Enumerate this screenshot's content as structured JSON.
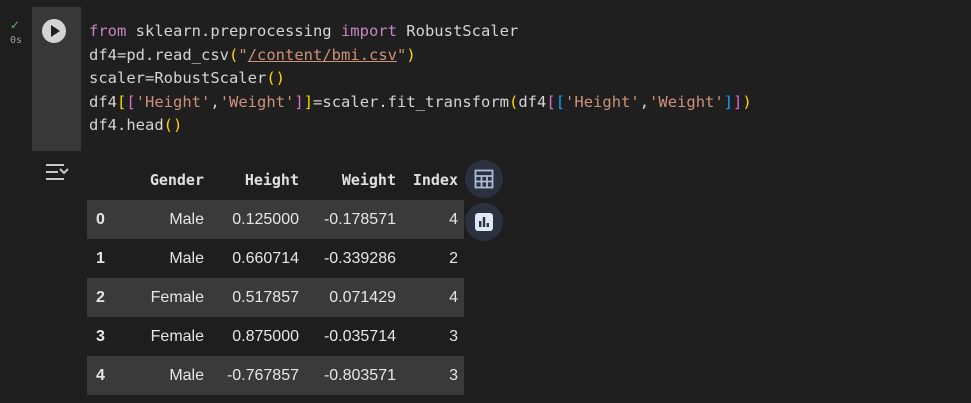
{
  "status": {
    "check": "✓",
    "time": "0s"
  },
  "code": {
    "line1_kw1": "from",
    "line1_mid": " sklearn.preprocessing ",
    "line1_kw2": "import",
    "line1_end": " RobustScaler",
    "line2_a": "df4=pd.read_csv",
    "line2_paren_open": "(",
    "line2_str_open": "\"",
    "line2_url": "/content/bmi.csv",
    "line2_str_close": "\"",
    "line2_paren_close": ")",
    "line3_a": "scaler=RobustScaler",
    "line3_parens": "()",
    "line4_a": "df4",
    "line4_b1o": "[",
    "line4_b2o": "[",
    "line4_s1": "'Height'",
    "line4_comma": ",",
    "line4_s2": "'Weight'",
    "line4_b2c": "]",
    "line4_b1c": "]",
    "line4_mid": "=scaler.fit_transform",
    "line4_po": "(",
    "line4_df": "df4",
    "line4_b3o": "[",
    "line4_b4o": "[",
    "line4_s3": "'Height'",
    "line4_comma2": ",",
    "line4_s4": "'Weight'",
    "line4_b4c": "]",
    "line4_b3c": "]",
    "line4_pc": ")",
    "line5_a": "df4.head",
    "line5_parens": "()"
  },
  "table": {
    "columns": [
      "",
      "Gender",
      "Height",
      "Weight",
      "Index"
    ],
    "rows": [
      [
        "0",
        "Male",
        "0.125000",
        "-0.178571",
        "4"
      ],
      [
        "1",
        "Male",
        "0.660714",
        "-0.339286",
        "2"
      ],
      [
        "2",
        "Female",
        "0.517857",
        "0.071429",
        "4"
      ],
      [
        "3",
        "Female",
        "0.875000",
        "-0.035714",
        "3"
      ],
      [
        "4",
        "Male",
        "-0.767857",
        "-0.803571",
        "3"
      ]
    ]
  },
  "icons": {
    "status": "check-icon",
    "run": "play-icon",
    "output": "output-collapse-icon",
    "table_view": "table-icon",
    "chart_suggest": "bar-chart-icon"
  }
}
